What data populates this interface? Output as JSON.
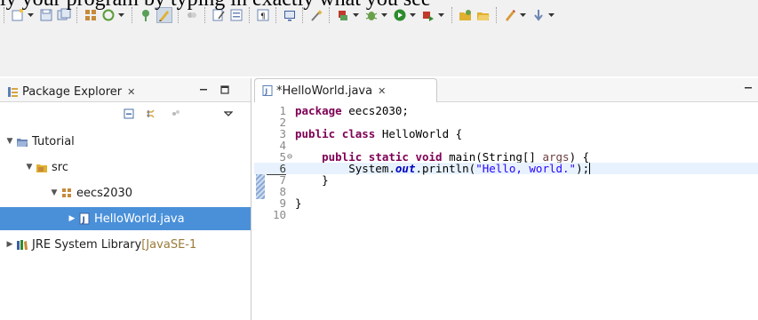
{
  "caption": "ly your program by typing in exactly what you see",
  "toolbar": {
    "buttons": [
      {
        "icon": "new-icon",
        "dropdown": true
      },
      {
        "icon": "save-icon",
        "dropdown": false
      },
      {
        "icon": "save-all-icon",
        "dropdown": false
      },
      {
        "icon": "build-icon",
        "dropdown": false
      },
      {
        "icon": "refresh-icon",
        "dropdown": true
      },
      {
        "icon": "pin-icon",
        "dropdown": false
      },
      {
        "icon": "highlight-icon",
        "dropdown": false,
        "active": true
      },
      {
        "icon": "link-icon",
        "dropdown": false
      },
      {
        "icon": "edit-icon",
        "dropdown": false
      },
      {
        "icon": "block-icon",
        "dropdown": false
      },
      {
        "icon": "paragraph-icon",
        "dropdown": false
      },
      {
        "icon": "console-icon",
        "dropdown": false
      },
      {
        "icon": "wand-icon",
        "dropdown": false
      },
      {
        "icon": "skip-icon",
        "dropdown": true
      },
      {
        "icon": "debug-icon",
        "dropdown": true
      },
      {
        "icon": "run-icon",
        "dropdown": true
      },
      {
        "icon": "external-tools-icon",
        "dropdown": true
      },
      {
        "icon": "new-package-icon",
        "dropdown": false
      },
      {
        "icon": "open-folder-icon",
        "dropdown": false
      },
      {
        "icon": "pencil-icon",
        "dropdown": true
      },
      {
        "icon": "next-annotation-icon",
        "dropdown": true
      }
    ]
  },
  "package_explorer": {
    "tab_label": "Package Explorer",
    "tab_close": "✕",
    "tree": [
      {
        "label": "Tutorial",
        "depth": 0,
        "expanded": true,
        "icon": "project-icon"
      },
      {
        "label": "src",
        "depth": 1,
        "expanded": true,
        "icon": "source-folder-icon"
      },
      {
        "label": "eecs2030",
        "depth": 2,
        "expanded": true,
        "icon": "package-icon"
      },
      {
        "label": "HelloWorld.java",
        "depth": 3,
        "expanded": false,
        "icon": "java-file-icon",
        "selected": true
      },
      {
        "label": "JRE System Library",
        "decoration": "[JavaSE-1",
        "depth": 0,
        "expanded": false,
        "icon": "library-icon"
      }
    ]
  },
  "editor": {
    "tab_label": "*HelloWorld.java",
    "tab_close": "✕",
    "lines": [
      {
        "n": "1",
        "tokens": [
          {
            "t": "package",
            "c": "kw"
          },
          {
            "t": " eecs2030;",
            "c": ""
          }
        ]
      },
      {
        "n": "2",
        "tokens": []
      },
      {
        "n": "3",
        "tokens": [
          {
            "t": "public",
            "c": "kw"
          },
          {
            "t": " ",
            "c": ""
          },
          {
            "t": "class",
            "c": "kw"
          },
          {
            "t": " HelloWorld {",
            "c": ""
          }
        ]
      },
      {
        "n": "4",
        "tokens": []
      },
      {
        "n": "5",
        "fold": "⊖",
        "tokens": [
          {
            "t": "    ",
            "c": ""
          },
          {
            "t": "public",
            "c": "kw"
          },
          {
            "t": " ",
            "c": ""
          },
          {
            "t": "static",
            "c": "kw"
          },
          {
            "t": " ",
            "c": ""
          },
          {
            "t": "void",
            "c": "kw"
          },
          {
            "t": " main(String[] ",
            "c": ""
          },
          {
            "t": "args",
            "c": "param"
          },
          {
            "t": ") {",
            "c": ""
          }
        ]
      },
      {
        "n": "6",
        "current": true,
        "tokens": [
          {
            "t": "        System.",
            "c": ""
          },
          {
            "t": "out",
            "c": "fld"
          },
          {
            "t": ".println(",
            "c": ""
          },
          {
            "t": "\"Hello, world.\"",
            "c": "str"
          },
          {
            "t": ");",
            "c": ""
          }
        ]
      },
      {
        "n": "7",
        "tokens": [
          {
            "t": "    }",
            "c": ""
          }
        ]
      },
      {
        "n": "8",
        "tokens": []
      },
      {
        "n": "9",
        "tokens": [
          {
            "t": "}",
            "c": ""
          }
        ]
      },
      {
        "n": "10",
        "tokens": []
      }
    ]
  },
  "colors": {
    "keyword": "#7f0055",
    "string": "#2a00ff",
    "field": "#0000c0",
    "selection": "#4a90d9",
    "current_line": "#e8f2fe"
  }
}
